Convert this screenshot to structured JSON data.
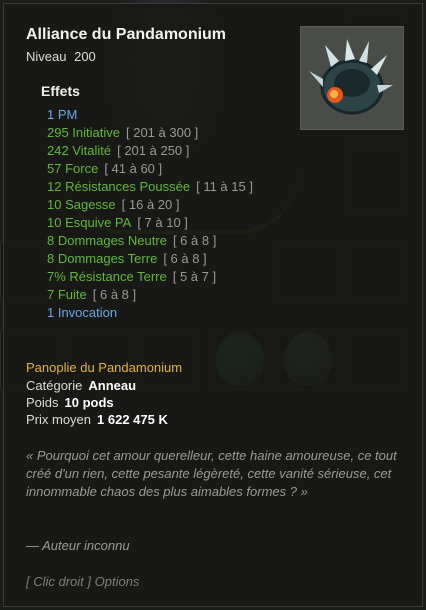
{
  "item": {
    "name": "Alliance du Pandamonium",
    "level_label": "Niveau",
    "level": "200"
  },
  "effects": {
    "title": "Effets",
    "items": [
      {
        "text": "1 PM",
        "range": "",
        "color": "blue"
      },
      {
        "text": "295 Initiative",
        "range": "[ 201 à 300 ]",
        "color": "green"
      },
      {
        "text": "242 Vitalité",
        "range": "[ 201 à 250 ]",
        "color": "green"
      },
      {
        "text": "57 Force",
        "range": "[ 41 à 60 ]",
        "color": "green"
      },
      {
        "text": "12 Résistances Poussée",
        "range": "[ 11 à 15 ]",
        "color": "green"
      },
      {
        "text": "10 Sagesse",
        "range": "[ 16 à 20 ]",
        "color": "green"
      },
      {
        "text": "10 Esquive PA",
        "range": "[ 7 à 10 ]",
        "color": "green"
      },
      {
        "text": "8 Dommages Neutre",
        "range": "[ 6 à 8 ]",
        "color": "green"
      },
      {
        "text": "8 Dommages Terre",
        "range": "[ 6 à 8 ]",
        "color": "green"
      },
      {
        "text": "7% Résistance Terre",
        "range": "[ 5 à 7 ]",
        "color": "green"
      },
      {
        "text": "7 Fuite",
        "range": "[ 6 à 8 ]",
        "color": "green"
      },
      {
        "text": "1 Invocation",
        "range": "",
        "color": "blue"
      }
    ]
  },
  "set": {
    "name": "Panoplie du Pandamonium"
  },
  "meta": {
    "category_label": "Catégorie",
    "category": "Anneau",
    "weight_label": "Poids",
    "weight": "10 pods",
    "price_label": "Prix moyen",
    "price": "1 622 475 K"
  },
  "description": {
    "quote": "« Pourquoi cet amour querelleur, cette haine amoureuse, ce tout créé d'un rien, cette pesante légèreté, cette vanité sérieuse, cet innommable chaos des plus aimables formes ? »",
    "author": "— Auteur inconnu"
  },
  "hint": {
    "options": "[ Clic droit ] Options"
  },
  "colors": {
    "green": "#5fb83a",
    "blue": "#6aa6e8",
    "gold": "#e3b43a",
    "range": "#9a9a94"
  },
  "icon": {
    "name": "spiked-ring-icon"
  }
}
